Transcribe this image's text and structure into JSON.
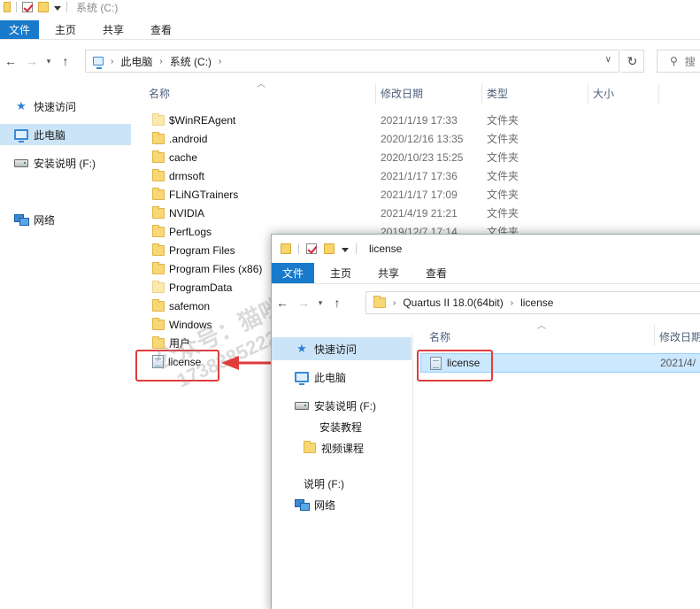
{
  "bg": {
    "title": "系统 (C:)",
    "ribbon_tabs": [
      "文件",
      "主页",
      "共享",
      "查看"
    ],
    "breadcrumb": [
      "此电脑",
      "系统 (C:)"
    ],
    "search_placeholder": "搜",
    "sidebar": [
      {
        "label": "快速访问",
        "icon": "star-icon"
      },
      {
        "label": "此电脑",
        "icon": "computer-icon",
        "selected": true
      },
      {
        "label": "安装说明 (F:)",
        "icon": "drive-icon"
      },
      {
        "label": "网络",
        "icon": "network-icon"
      }
    ],
    "columns": {
      "name": "名称",
      "date": "修改日期",
      "type": "类型",
      "size": "大小"
    },
    "rows": [
      {
        "name": "$WinREAgent",
        "date": "2021/1/19 17:33",
        "type": "文件夹",
        "light": true
      },
      {
        "name": ".android",
        "date": "2020/12/16 13:35",
        "type": "文件夹"
      },
      {
        "name": "cache",
        "date": "2020/10/23 15:25",
        "type": "文件夹"
      },
      {
        "name": "drmsoft",
        "date": "2021/1/17 17:36",
        "type": "文件夹"
      },
      {
        "name": "FLiNGTrainers",
        "date": "2021/1/17 17:09",
        "type": "文件夹"
      },
      {
        "name": "NVIDIA",
        "date": "2021/4/19 21:21",
        "type": "文件夹"
      },
      {
        "name": "PerfLogs",
        "date": "2019/12/7 17:14",
        "type": "文件夹"
      },
      {
        "name": "Program Files",
        "date": "",
        "type": ""
      },
      {
        "name": "Program Files (x86)",
        "date": "",
        "type": ""
      },
      {
        "name": "ProgramData",
        "date": "",
        "type": "",
        "light": true
      },
      {
        "name": "safemon",
        "date": "",
        "type": ""
      },
      {
        "name": "Windows",
        "date": "",
        "type": ""
      },
      {
        "name": "用户",
        "date": "",
        "type": ""
      },
      {
        "name": "license",
        "date": "",
        "type": "",
        "file": true
      }
    ]
  },
  "fg": {
    "title": "license",
    "ribbon_tabs": [
      "文件",
      "主页",
      "共享",
      "查看"
    ],
    "breadcrumb": [
      "Quartus II 18.0(64bit)",
      "license"
    ],
    "sidebar": [
      {
        "label": "快速访问",
        "icon": "star-icon",
        "selected": true
      },
      {
        "label": "此电脑",
        "icon": "computer-icon"
      },
      {
        "label": "安装说明 (F:)",
        "icon": "drive-icon"
      },
      {
        "label": "安装教程",
        "icon": "folder-icon"
      },
      {
        "label": "视频课程",
        "icon": "folder-icon"
      },
      {
        "label": "说明 (F:)",
        "icon": "drive-icon"
      },
      {
        "label": "网络",
        "icon": "network-icon"
      }
    ],
    "columns": {
      "name": "名称",
      "date": "修改日期"
    },
    "row": {
      "name": "license",
      "date": "2021/4/"
    }
  },
  "watermark": [
    "公众号：猫咪软件社",
    "1738385222.xyz"
  ],
  "colors": {
    "accent": "#1979ca",
    "highlight": "#e03c3c",
    "selection": "#cce8ff"
  }
}
